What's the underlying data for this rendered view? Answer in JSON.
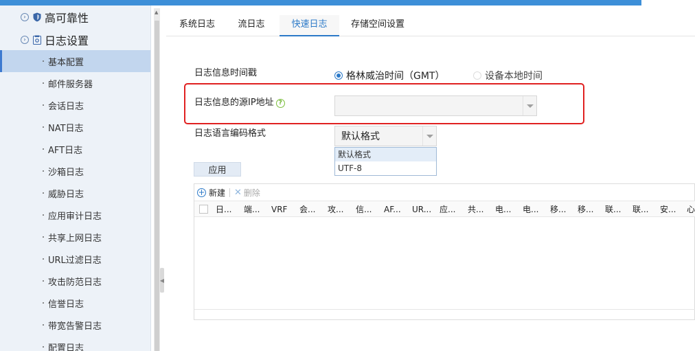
{
  "sidebar": {
    "groups": [
      {
        "label": "高可靠性"
      },
      {
        "label": "日志设置"
      }
    ],
    "items": [
      {
        "label": "基本配置"
      },
      {
        "label": "邮件服务器"
      },
      {
        "label": "会话日志"
      },
      {
        "label": "NAT日志"
      },
      {
        "label": "AFT日志"
      },
      {
        "label": "沙箱日志"
      },
      {
        "label": "威胁日志"
      },
      {
        "label": "应用审计日志"
      },
      {
        "label": "共享上网日志"
      },
      {
        "label": "URL过滤日志"
      },
      {
        "label": "攻击防范日志"
      },
      {
        "label": "信誉日志"
      },
      {
        "label": "带宽告警日志"
      },
      {
        "label": "配置日志"
      }
    ]
  },
  "tabs": [
    {
      "label": "系统日志"
    },
    {
      "label": "流日志"
    },
    {
      "label": "快速日志"
    },
    {
      "label": "存储空间设置"
    }
  ],
  "form": {
    "timestamp_label": "日志信息时间戳",
    "radio_gmt": "格林威治时间（GMT）",
    "radio_local": "设备本地时间",
    "source_ip_label": "日志信息的源IP地址",
    "source_ip_value": "",
    "encoding_label": "日志语言编码格式",
    "encoding_value": "默认格式",
    "encoding_options": [
      "默认格式",
      "UTF-8"
    ],
    "apply_label": "应用"
  },
  "grid": {
    "add_label": "新建",
    "delete_label": "删除",
    "columns": [
      "日...",
      "端...",
      "VRF",
      "会...",
      "攻...",
      "信...",
      "AF...",
      "UR...",
      "应...",
      "共...",
      "电...",
      "电...",
      "移...",
      "移...",
      "联...",
      "联...",
      "安...",
      "心"
    ]
  }
}
